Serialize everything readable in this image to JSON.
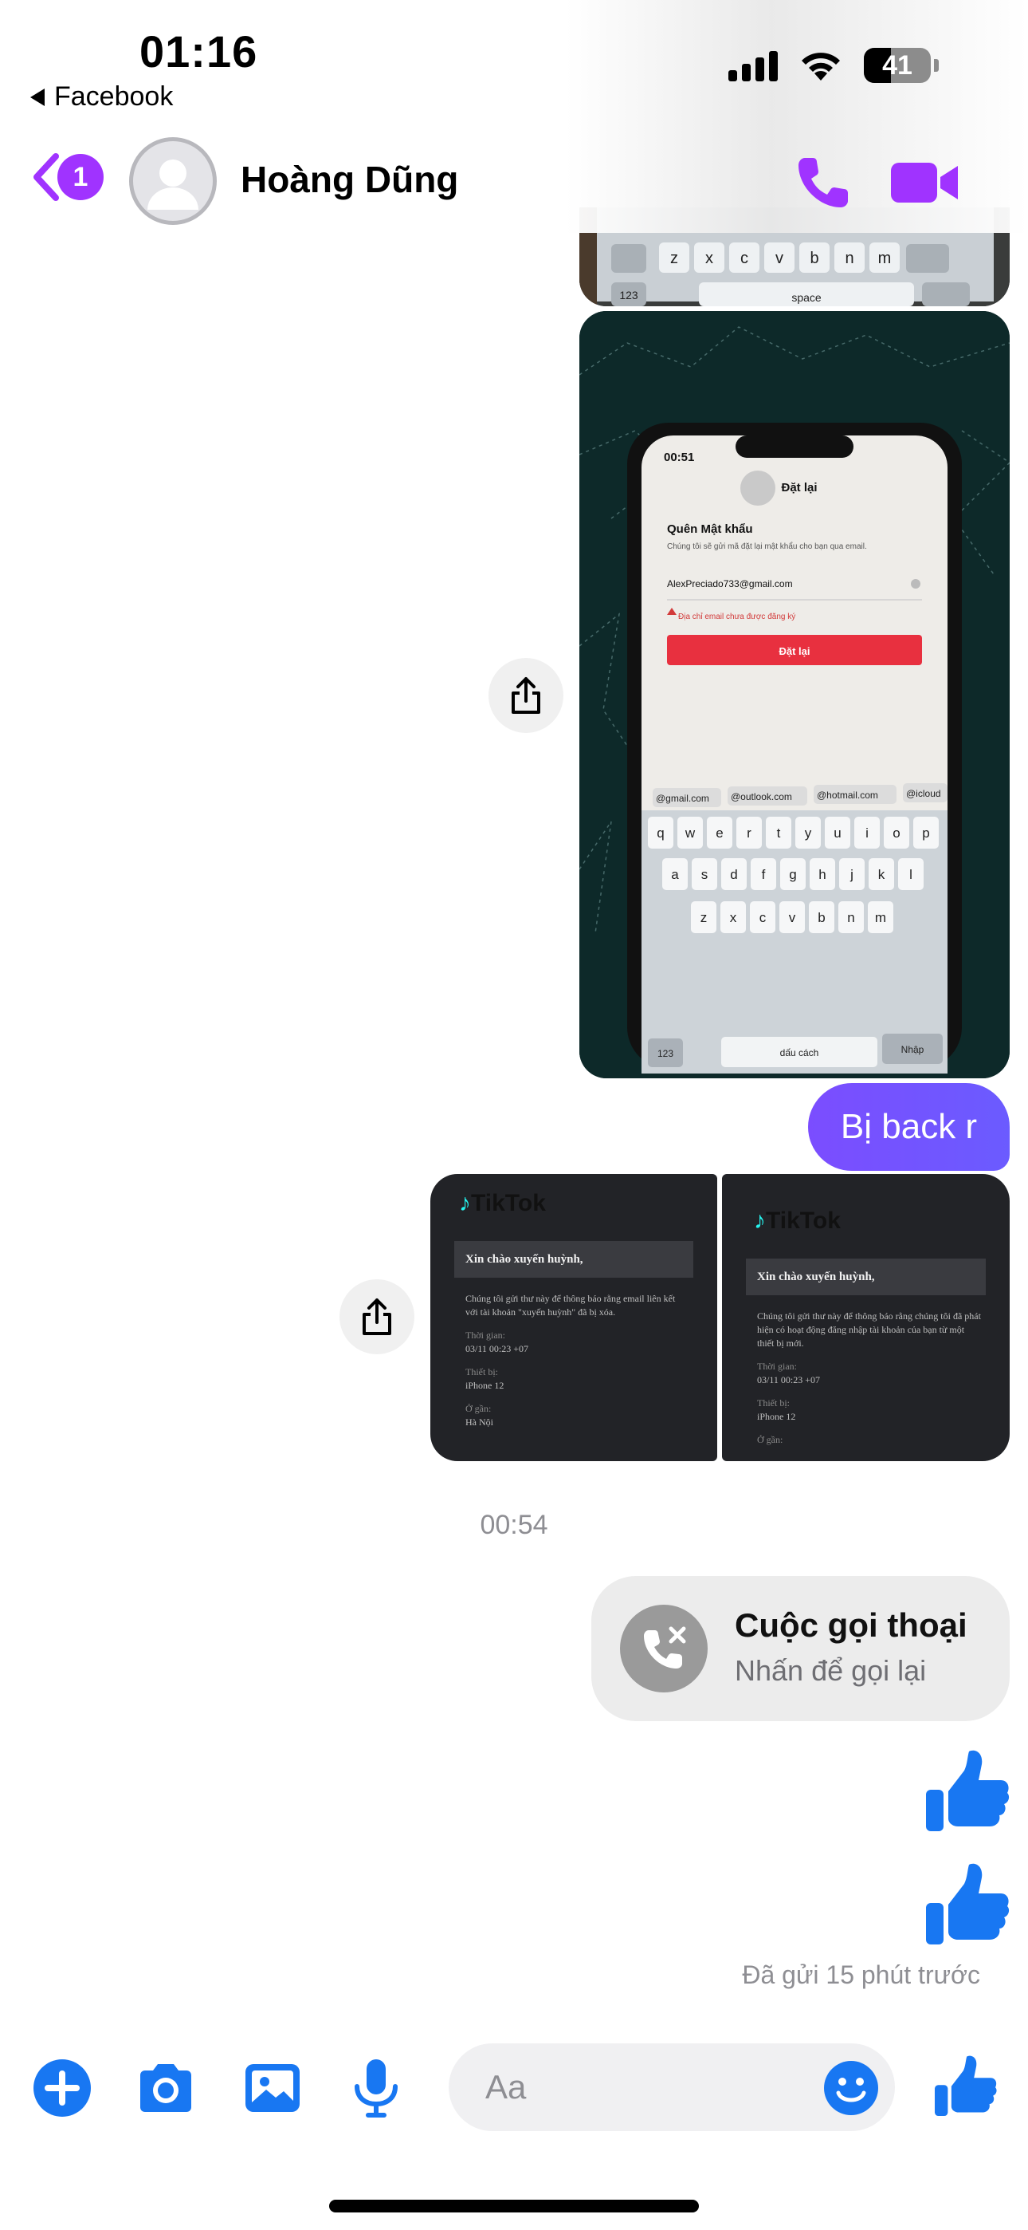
{
  "status_bar": {
    "time": "01:16",
    "back_app": "Facebook",
    "battery_level": "41",
    "battery_fraction": 0.41
  },
  "header": {
    "back_badge": "1",
    "contact_name": "Hoàng Dũng",
    "accent": "#a033ff"
  },
  "messages": {
    "phone_screenshot": {
      "time": "00:51",
      "title": "Đặt lại",
      "heading": "Quên Mật khẩu",
      "subtext": "Chúng tôi sẽ gửi mã đặt lại mật khẩu cho bạn qua email.",
      "email": "AlexPreciado733@gmail.com",
      "error": "Địa chỉ email chưa được đăng ký",
      "button": "Đặt lại",
      "suggestions": [
        "@gmail.com",
        "@outlook.com",
        "@hotmail.com",
        "@icloud"
      ],
      "keyboard_rows": [
        [
          "q",
          "w",
          "e",
          "r",
          "t",
          "y",
          "u",
          "i",
          "o",
          "p"
        ],
        [
          "a",
          "s",
          "d",
          "f",
          "g",
          "h",
          "j",
          "k",
          "l"
        ],
        [
          "z",
          "x",
          "c",
          "v",
          "b",
          "n",
          "m"
        ]
      ],
      "key_123": "123",
      "space_label": "dấu cách",
      "return_label": "Nhập"
    },
    "top_keyboard_keys": [
      "z",
      "x",
      "c",
      "v",
      "b",
      "n",
      "m"
    ],
    "top_keyboard_123": "123",
    "top_keyboard_space": "space",
    "text_bubble": "Bị back r",
    "bubble_color": "#6f55ff",
    "tiktok_left": {
      "brand": "TikTok",
      "greeting": "Xin chào xuyến huỳnh,",
      "body": "Chúng tôi gửi thư này để thông báo rằng email liên kết với tài khoản \"xuyến huỳnh\" đã bị xóa.",
      "time_label": "Thời gian:",
      "time_value": "03/11 00:23 +07",
      "device_label": "Thiết bị:",
      "device_value": "iPhone 12",
      "location_label": "Ở gần:",
      "location_value": "Hà Nội"
    },
    "tiktok_right": {
      "brand": "TikTok",
      "greeting": "Xin chào xuyến huỳnh,",
      "body": "Chúng tôi gửi thư này để thông báo rằng chúng tôi đã phát hiện có hoạt động đăng nhập tài khoản của bạn từ một thiết bị mới.",
      "time_label": "Thời gian:",
      "time_value": "03/11 00:23 +07",
      "device_label": "Thiết bị:",
      "device_value": "iPhone 12",
      "location_label": "Ở gần:"
    },
    "timestamp": "00:54",
    "call": {
      "title": "Cuộc gọi thoại",
      "subtitle": "Nhấn để gọi lại"
    },
    "sent_status": "Đã gửi 15 phút trước"
  },
  "composer": {
    "placeholder": "Aa",
    "icon_color": "#1877f2",
    "icons": [
      "plus-icon",
      "camera-icon",
      "gallery-icon",
      "microphone-icon",
      "emoji-icon",
      "like-icon"
    ]
  }
}
